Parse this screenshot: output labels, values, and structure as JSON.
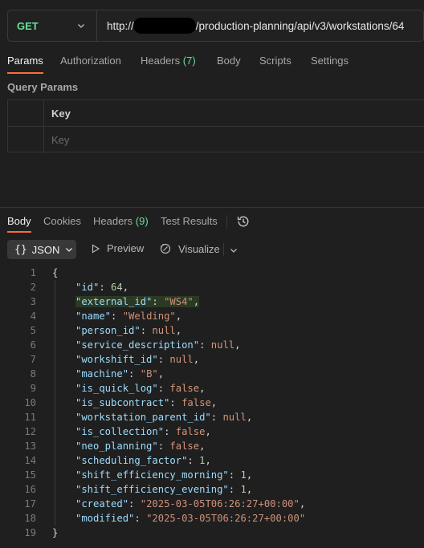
{
  "request": {
    "method": "GET",
    "url_prefix": "http://",
    "url_suffix": "/production-planning/api/v3/workstations/64"
  },
  "req_tabs": [
    {
      "label": "Params",
      "count": ""
    },
    {
      "label": "Authorization",
      "count": ""
    },
    {
      "label": "Headers",
      "count": "(7)"
    },
    {
      "label": "Body",
      "count": ""
    },
    {
      "label": "Scripts",
      "count": ""
    },
    {
      "label": "Settings",
      "count": ""
    }
  ],
  "query_params": {
    "title": "Query Params",
    "header_key": "Key",
    "placeholder_key": "Key"
  },
  "resp_tabs": [
    {
      "label": "Body",
      "count": ""
    },
    {
      "label": "Cookies",
      "count": ""
    },
    {
      "label": "Headers",
      "count": "(9)"
    },
    {
      "label": "Test Results",
      "count": ""
    }
  ],
  "format": {
    "json_label": "JSON",
    "braces": "{}",
    "preview_label": "Preview",
    "visualize_label": "Visualize"
  },
  "code_lines": [
    {
      "n": "1",
      "type": "open",
      "text": "{"
    },
    {
      "n": "2",
      "key": "\"id\"",
      "val": "64",
      "vt": "n",
      "comma": ","
    },
    {
      "n": "3",
      "key": "\"external_id\"",
      "val": "\"WS4\"",
      "vt": "s",
      "comma": ",",
      "hl": true
    },
    {
      "n": "4",
      "key": "\"name\"",
      "val": "\"Welding\"",
      "vt": "s",
      "comma": ","
    },
    {
      "n": "5",
      "key": "\"person_id\"",
      "val": "null",
      "vt": "nl",
      "comma": ","
    },
    {
      "n": "6",
      "key": "\"service_description\"",
      "val": "null",
      "vt": "nl",
      "comma": ","
    },
    {
      "n": "7",
      "key": "\"workshift_id\"",
      "val": "null",
      "vt": "nl",
      "comma": ","
    },
    {
      "n": "8",
      "key": "\"machine\"",
      "val": "\"B\"",
      "vt": "s",
      "comma": ","
    },
    {
      "n": "9",
      "key": "\"is_quick_log\"",
      "val": "false",
      "vt": "b",
      "comma": ","
    },
    {
      "n": "10",
      "key": "\"is_subcontract\"",
      "val": "false",
      "vt": "b",
      "comma": ","
    },
    {
      "n": "11",
      "key": "\"workstation_parent_id\"",
      "val": "null",
      "vt": "nl",
      "comma": ","
    },
    {
      "n": "12",
      "key": "\"is_collection\"",
      "val": "false",
      "vt": "b",
      "comma": ","
    },
    {
      "n": "13",
      "key": "\"neo_planning\"",
      "val": "false",
      "vt": "b",
      "comma": ","
    },
    {
      "n": "14",
      "key": "\"scheduling_factor\"",
      "val": "1",
      "vt": "n",
      "comma": ","
    },
    {
      "n": "15",
      "key": "\"shift_efficiency_morning\"",
      "val": "1",
      "vt": "n",
      "comma": ","
    },
    {
      "n": "16",
      "key": "\"shift_efficiency_evening\"",
      "val": "1",
      "vt": "n",
      "comma": ","
    },
    {
      "n": "17",
      "key": "\"created\"",
      "val": "\"2025-03-05T06:26:27+00:00\"",
      "vt": "s",
      "comma": ","
    },
    {
      "n": "18",
      "key": "\"modified\"",
      "val": "\"2025-03-05T06:26:27+00:00\"",
      "vt": "s",
      "comma": ""
    },
    {
      "n": "19",
      "type": "close",
      "text": "}"
    }
  ],
  "colors": {
    "method": "#6bdd9a",
    "active_tab_underline": "#ff6c37",
    "key": "#9cdcfe",
    "string": "#ce9178",
    "number": "#b5cea8"
  }
}
